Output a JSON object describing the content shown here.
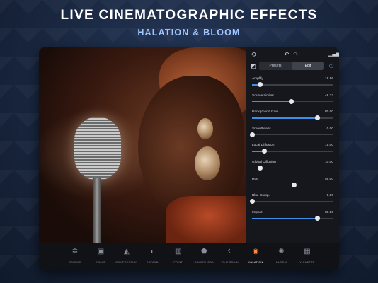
{
  "header": {
    "title": "LIVE CINEMATOGRAPHIC EFFECTS",
    "subtitle": "HALATION & BLOOM"
  },
  "panel": {
    "tabs": [
      "Presets",
      "Edit"
    ],
    "active_tab": "Edit",
    "sliders": [
      {
        "label": "Amplify",
        "value": "19.96",
        "level": 0.1
      },
      {
        "label": "Source Limiter",
        "value": "48.33",
        "level": 0.48
      },
      {
        "label": "Background Gain",
        "value": "80.00",
        "level": 0.8
      },
      {
        "label": "Smoothness",
        "value": "0.00",
        "level": 0.0
      },
      {
        "label": "Local Diffusion",
        "value": "15.00",
        "level": 0.15
      },
      {
        "label": "Global Diffusion",
        "value": "10.00",
        "level": 0.1
      },
      {
        "label": "Hue",
        "value": "59.00",
        "level": 0.52
      },
      {
        "label": "Blue Comp.",
        "value": "0.00",
        "level": 0.0
      },
      {
        "label": "Impact",
        "value": "80.00",
        "level": 0.8
      }
    ],
    "accent_color": "#3d8fe6"
  },
  "toolbar": {
    "tools": [
      {
        "name": "SOURCE",
        "icon": "gear-icon"
      },
      {
        "name": "FILMS",
        "icon": "film-icon"
      },
      {
        "name": "COMPRESSION",
        "icon": "compression-icon"
      },
      {
        "name": "EXPAND",
        "icon": "expand-icon"
      },
      {
        "name": "PRINT",
        "icon": "print-icon"
      },
      {
        "name": "COLOR HEAD",
        "icon": "color-head-icon"
      },
      {
        "name": "FILM GRAIN",
        "icon": "grain-icon"
      },
      {
        "name": "HALATION",
        "icon": "halation-icon",
        "active": true
      },
      {
        "name": "BLOOM",
        "icon": "bloom-icon"
      },
      {
        "name": "VIGNETTE",
        "icon": "vignette-icon"
      }
    ],
    "active_color": "#ff8a3d"
  }
}
